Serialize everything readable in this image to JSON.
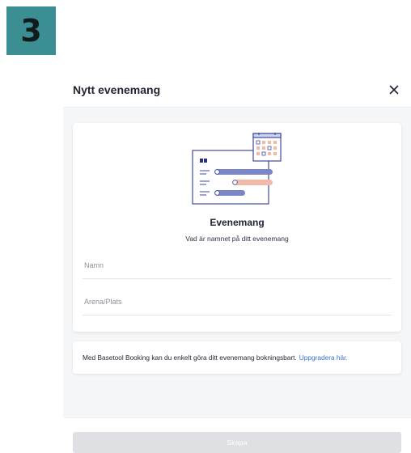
{
  "step_badge": "3",
  "modal": {
    "title": "Nytt evenemang",
    "close_icon": "close-icon"
  },
  "card": {
    "illustration_icon": "event-calendar-illustration-icon",
    "title": "Evenemang",
    "subtitle": "Vad är namnet på ditt evenemang",
    "fields": {
      "name": {
        "placeholder": "Namn",
        "value": ""
      },
      "venue": {
        "placeholder": "Arena/Plats",
        "value": ""
      }
    }
  },
  "info": {
    "text": "Med Basetool Booking kan du enkelt göra ditt evenemang bokningsbart.",
    "link_text": "Uppgradera här."
  },
  "footer": {
    "submit_label": "Skapa",
    "submit_disabled": true
  },
  "colors": {
    "badge": "#3b8f92",
    "link": "#3a6fd1",
    "illustration_primary": "#7a86c8",
    "illustration_accent": "#f2b8a8",
    "disabled_button": "#dfe0e3"
  }
}
